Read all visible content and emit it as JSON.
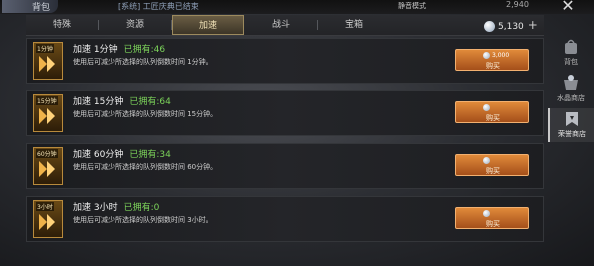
{
  "header": {
    "title": "背包",
    "notice": "[系统] 工匠庆典已结束",
    "mode": "静音模式",
    "resource_value": "2,940"
  },
  "tabs": [
    {
      "label": "特殊",
      "active": false
    },
    {
      "label": "资源",
      "active": false
    },
    {
      "label": "加速",
      "active": true
    },
    {
      "label": "战斗",
      "active": false
    },
    {
      "label": "宝箱",
      "active": false
    }
  ],
  "currency": {
    "value": "5,130",
    "icon": "crystal-coin-icon"
  },
  "items": [
    {
      "badge": "1分钟",
      "name": "加速 1分钟",
      "owned": "已拥有:46",
      "desc": "使用后可减少所选择的队列倒数时间 1分钟。",
      "price": "3,000",
      "buy_label": "购买"
    },
    {
      "badge": "15分钟",
      "name": "加速 15分钟",
      "owned": "已拥有:64",
      "desc": "使用后可减少所选择的队列倒数时间 15分钟。",
      "price": "",
      "buy_label": "购买"
    },
    {
      "badge": "60分钟",
      "name": "加速 60分钟",
      "owned": "已拥有:34",
      "desc": "使用后可减少所选择的队列倒数时间 60分钟。",
      "price": "",
      "buy_label": "购买"
    },
    {
      "badge": "3小时",
      "name": "加速 3小时",
      "owned": "已拥有:0",
      "desc": "使用后可减少所选择的队列倒数时间 3小时。",
      "price": "",
      "buy_label": "购买"
    }
  ],
  "side_nav": [
    {
      "label": "背包",
      "icon": "bag-icon",
      "active": false
    },
    {
      "label": "水晶商店",
      "icon": "crystal-shop-icon",
      "active": false
    },
    {
      "label": "荣誉商店",
      "icon": "honor-shop-icon",
      "active": true
    }
  ],
  "colors": {
    "accent": "#c98a3a",
    "owned_green": "#7cd35a",
    "buy_orange": "#d7762c"
  }
}
